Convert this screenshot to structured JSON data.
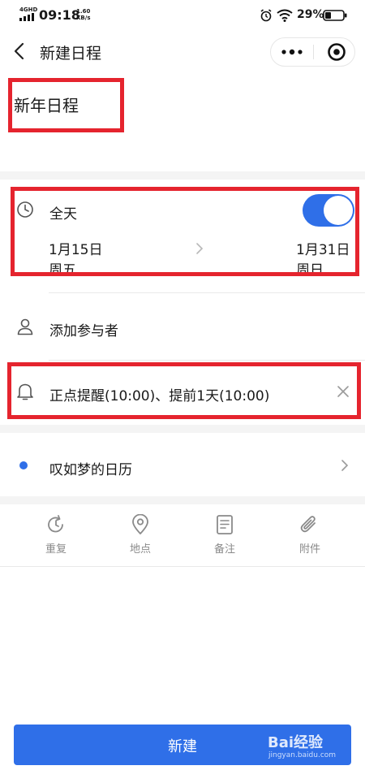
{
  "status_bar": {
    "network": "4GHD",
    "time": "09:18",
    "speed_value": "1.60",
    "speed_unit": "KB/s",
    "battery": "29%"
  },
  "nav": {
    "title": "新建日程"
  },
  "event": {
    "title": "新年日程"
  },
  "all_day": {
    "label": "全天",
    "enabled": true,
    "start_date": "1月15日",
    "start_weekday": "周五",
    "end_date": "1月31日",
    "end_weekday": "周日"
  },
  "participants": {
    "label": "添加参与者"
  },
  "reminder": {
    "text": "正点提醒(10:00)、提前1天(10:00)"
  },
  "calendar": {
    "name": "叹如梦的日历",
    "dot_color": "#2f6fe8"
  },
  "toolbar": {
    "repeat": "重复",
    "location": "地点",
    "note": "备注",
    "attachment": "附件"
  },
  "primary_button": {
    "label": "新建"
  },
  "watermark": {
    "brand": "Bai经验",
    "url": "jingyan.baidu.com"
  },
  "colors": {
    "accent": "#2f6fe8",
    "annotation": "#e5242e"
  }
}
